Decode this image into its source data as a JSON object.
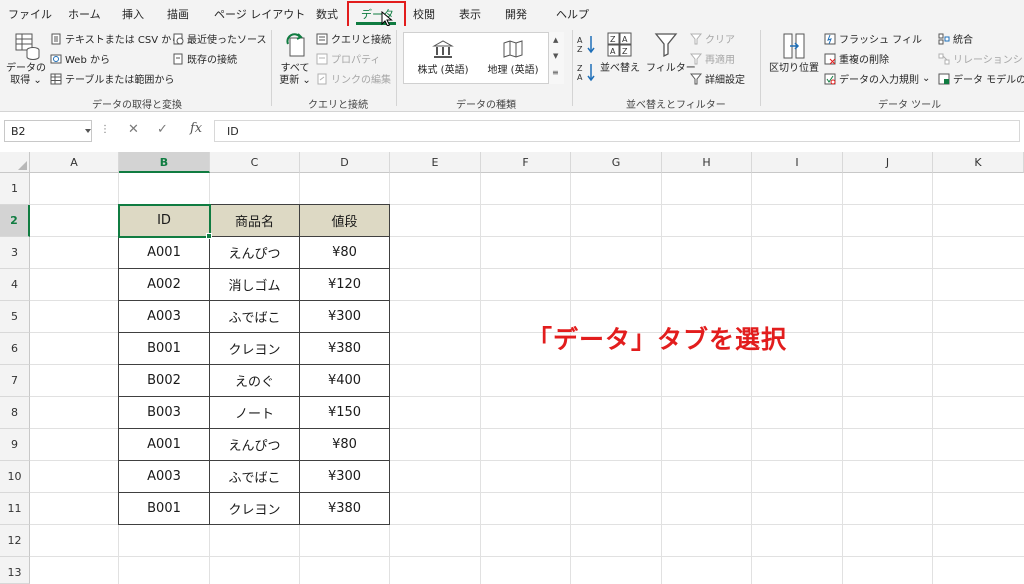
{
  "tabs": [
    {
      "label": "ファイル",
      "active": false
    },
    {
      "label": "ホーム",
      "active": false
    },
    {
      "label": "挿入",
      "active": false
    },
    {
      "label": "描画",
      "active": false
    },
    {
      "label": "ページ レイアウト",
      "active": false
    },
    {
      "label": "数式",
      "active": false
    },
    {
      "label": "データ",
      "active": true
    },
    {
      "label": "校閲",
      "active": false
    },
    {
      "label": "表示",
      "active": false
    },
    {
      "label": "開発",
      "active": false
    },
    {
      "label": "ヘルプ",
      "active": false
    }
  ],
  "ribbon": {
    "get_transform": {
      "get_data_line1": "データの",
      "get_data_line2": "取得",
      "from_text_csv": "テキストまたは CSV から",
      "from_web": "Web から",
      "from_table": "テーブルまたは範囲から",
      "recent_sources": "最近使ったソース",
      "existing_connections": "既存の接続",
      "group_label": "データの取得と変換"
    },
    "queries": {
      "refresh_all_line1": "すべて",
      "refresh_all_line2": "更新",
      "queries_connections": "クエリと接続",
      "properties": "プロパティ",
      "edit_links": "リンクの編集",
      "group_label": "クエリと接続"
    },
    "data_types": {
      "stocks": "株式 (英語)",
      "geography": "地理 (英語)",
      "group_label": "データの種類"
    },
    "sort_filter": {
      "sort": "並べ替え",
      "filter": "フィルター",
      "clear": "クリア",
      "reapply": "再適用",
      "advanced": "詳細設定",
      "group_label": "並べ替えとフィルター"
    },
    "data_tools": {
      "text_to_columns": "区切り位置",
      "flash_fill": "フラッシュ フィル",
      "remove_duplicates": "重複の削除",
      "data_validation": "データの入力規則",
      "consolidate": "統合",
      "relationships": "リレーションシップ",
      "data_model": "データ モデルの管",
      "group_label": "データ ツール"
    }
  },
  "formula_bar": {
    "name_box": "B2",
    "fx": "fx",
    "value": "ID"
  },
  "columns": [
    "A",
    "B",
    "C",
    "D",
    "E",
    "F",
    "G",
    "H",
    "I",
    "J",
    "K"
  ],
  "rows": [
    "1",
    "2",
    "3",
    "4",
    "5",
    "6",
    "7",
    "8",
    "9",
    "10",
    "11",
    "12",
    "13"
  ],
  "selected_column": "B",
  "selected_row": "2",
  "table": {
    "headers": [
      "ID",
      "商品名",
      "値段"
    ],
    "rows": [
      [
        "A001",
        "えんぴつ",
        "¥80"
      ],
      [
        "A002",
        "消しゴム",
        "¥120"
      ],
      [
        "A003",
        "ふでばこ",
        "¥300"
      ],
      [
        "B001",
        "クレヨン",
        "¥380"
      ],
      [
        "B002",
        "えのぐ",
        "¥400"
      ],
      [
        "B003",
        "ノート",
        "¥150"
      ],
      [
        "A001",
        "えんぴつ",
        "¥80"
      ],
      [
        "A003",
        "ふでばこ",
        "¥300"
      ],
      [
        "B001",
        "クレヨン",
        "¥380"
      ]
    ]
  },
  "annotation": "「データ」タブを選択",
  "colors": {
    "accent_green": "#107c41",
    "highlight_red": "#e21d1d",
    "table_header_fill": "#ddd9c4"
  }
}
